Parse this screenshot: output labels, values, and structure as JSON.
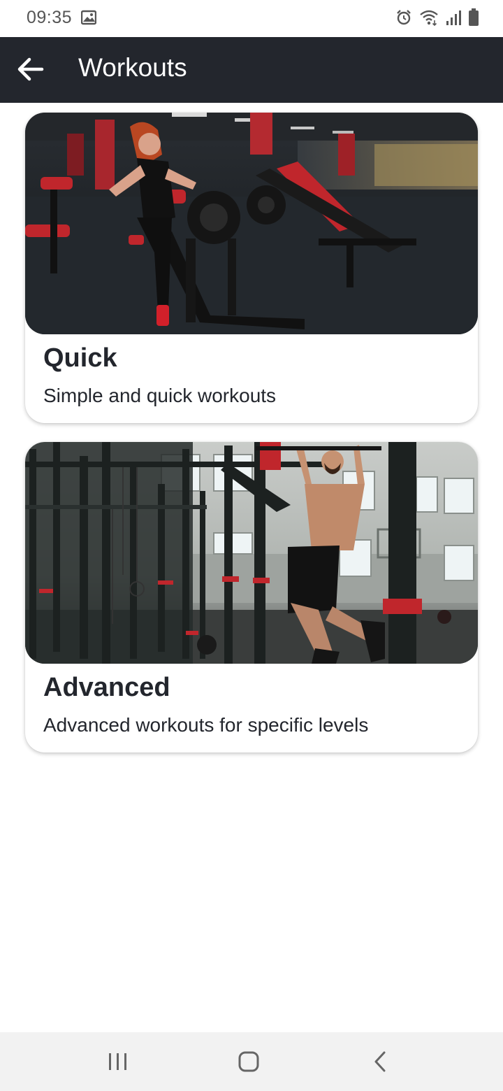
{
  "status_bar": {
    "time": "09:35",
    "icons": [
      "image-icon",
      "alarm-icon",
      "wifi-icon",
      "signal-icon",
      "battery-icon"
    ]
  },
  "app_bar": {
    "title": "Workouts",
    "back_icon": "arrow-left-icon",
    "background": "#23262d"
  },
  "cards": [
    {
      "title": "Quick",
      "subtitle": "Simple and quick workouts",
      "image": "gym-machines-photo"
    },
    {
      "title": "Advanced",
      "subtitle": "Advanced workouts for specific levels",
      "image": "pull-up-rig-photo"
    }
  ],
  "nav_bar": {
    "icons": [
      "recents-icon",
      "home-icon",
      "back-chevron-icon"
    ]
  }
}
